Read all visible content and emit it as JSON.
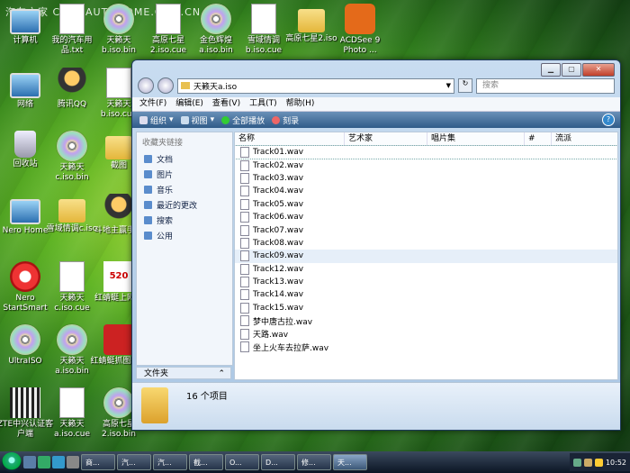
{
  "watermark": "汽车之家 CHAT.AUTOHOME.COM.CN",
  "desktop_icons": [
    {
      "label": "计算机",
      "icon": "computer-icon"
    },
    {
      "label": "我的汽车用品.txt",
      "icon": "text-file-icon"
    },
    {
      "label": "天籁天b.iso.bin",
      "icon": "disc-image-icon"
    },
    {
      "label": "高原七星2.iso.cue",
      "icon": "cue-file-icon"
    },
    {
      "label": "金色辉煌a.iso.bin",
      "icon": "disc-image-icon"
    },
    {
      "label": "雪域情调b.iso.cue",
      "icon": "cue-file-icon"
    },
    {
      "label": "高原七星2.iso",
      "icon": "folder-icon"
    },
    {
      "label": "ACDSee 9 Photo ...",
      "icon": "camera-icon"
    },
    {
      "label": "网络",
      "icon": "network-icon"
    },
    {
      "label": "腾讯QQ",
      "icon": "qq-penguin-icon"
    },
    {
      "label": "天籁天b.iso.cue",
      "icon": "cue-file-icon"
    },
    {
      "label": "回收站",
      "icon": "recycle-bin-icon"
    },
    {
      "label": "天籁天c.iso.bin",
      "icon": "disc-image-icon"
    },
    {
      "label": "截图",
      "icon": "folder-icon"
    },
    {
      "label": "Nero Home",
      "icon": "nero-home-icon"
    },
    {
      "label": "雪域情调c.iso",
      "icon": "folder-icon"
    },
    {
      "label": "斗地主赢手卡",
      "icon": "game-icon"
    },
    {
      "label": "Nero StartSmart",
      "icon": "nero-icon"
    },
    {
      "label": "天籁天c.iso.cue",
      "icon": "cue-file-icon"
    },
    {
      "label": "红蜻蜓上网航",
      "icon": "browser-icon"
    },
    {
      "label": "UltraISO",
      "icon": "ultraiso-icon"
    },
    {
      "label": "天籁天a.iso.bin",
      "icon": "disc-image-icon"
    },
    {
      "label": "红蜻蜓抓图精灵",
      "icon": "capture-tool-icon"
    },
    {
      "label": "ZTE中兴认证客户端",
      "icon": "zte-client-icon"
    },
    {
      "label": "天籁天a.iso.cue",
      "icon": "cue-file-icon"
    },
    {
      "label": "高原七星2.iso.bin",
      "icon": "disc-image-icon"
    },
    {
      "label": "b.iso.cue",
      "icon": "cue-file-icon"
    },
    {
      "label": "b.iso.bin",
      "icon": "disc-image-icon"
    },
    {
      "label": "a.iso",
      "icon": "folder-icon"
    }
  ],
  "window": {
    "address": "天籁天a.iso",
    "search_placeholder": "搜索",
    "menus": [
      "文件(F)",
      "编辑(E)",
      "查看(V)",
      "工具(T)",
      "帮助(H)"
    ],
    "toolbar": {
      "organize": "组织",
      "views": "视图",
      "play_all": "全部播放",
      "burn": "刻录"
    },
    "nav_header": "收藏夹链接",
    "nav_items": [
      "文档",
      "图片",
      "音乐",
      "最近的更改",
      "搜索",
      "公用"
    ],
    "folders_label": "文件夹",
    "columns": [
      "名称",
      "艺术家",
      "唱片集",
      "#",
      "流派"
    ],
    "files": [
      "Track01.wav",
      "Track02.wav",
      "Track03.wav",
      "Track04.wav",
      "Track05.wav",
      "Track06.wav",
      "Track07.wav",
      "Track08.wav",
      "Track09.wav",
      "Track12.wav",
      "Track13.wav",
      "Track14.wav",
      "Track15.wav",
      "梦中唐古拉.wav",
      "天路.wav",
      "坐上火车去拉萨.wav"
    ],
    "item_count": "16 个项目"
  },
  "taskbar": {
    "buttons": [
      "商...",
      "汽...",
      "汽...",
      "截...",
      "O...",
      "D...",
      "修...",
      "天..."
    ],
    "clock": "10:52"
  }
}
